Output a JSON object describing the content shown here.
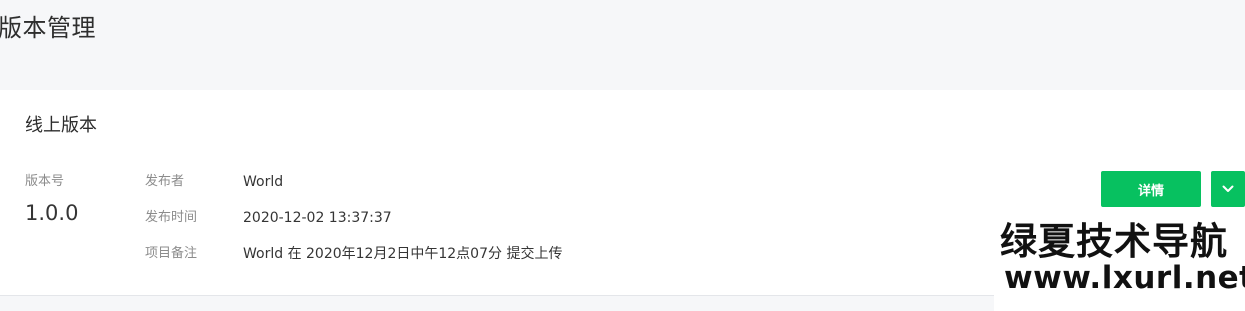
{
  "header": {
    "title": "版本管理"
  },
  "online_version": {
    "title": "线上版本",
    "version_label": "版本号",
    "version_number": "1.0.0",
    "details": [
      {
        "label": "发布者",
        "value": "World"
      },
      {
        "label": "发布时间",
        "value": "2020-12-02 13:37:37"
      },
      {
        "label": "项目备注",
        "value": "World 在 2020年12月2日中午12点07分 提交上传"
      }
    ],
    "detail_button_label": "详情",
    "more_icon": "chevron-down-icon"
  },
  "watermark": {
    "line1": "绿夏技术导航",
    "line2": "www.lxurl.net"
  },
  "colors": {
    "accent": "#07c160",
    "page_bg": "#f6f7f9",
    "card_bg": "#ffffff",
    "label_text": "#8c8c8c"
  }
}
